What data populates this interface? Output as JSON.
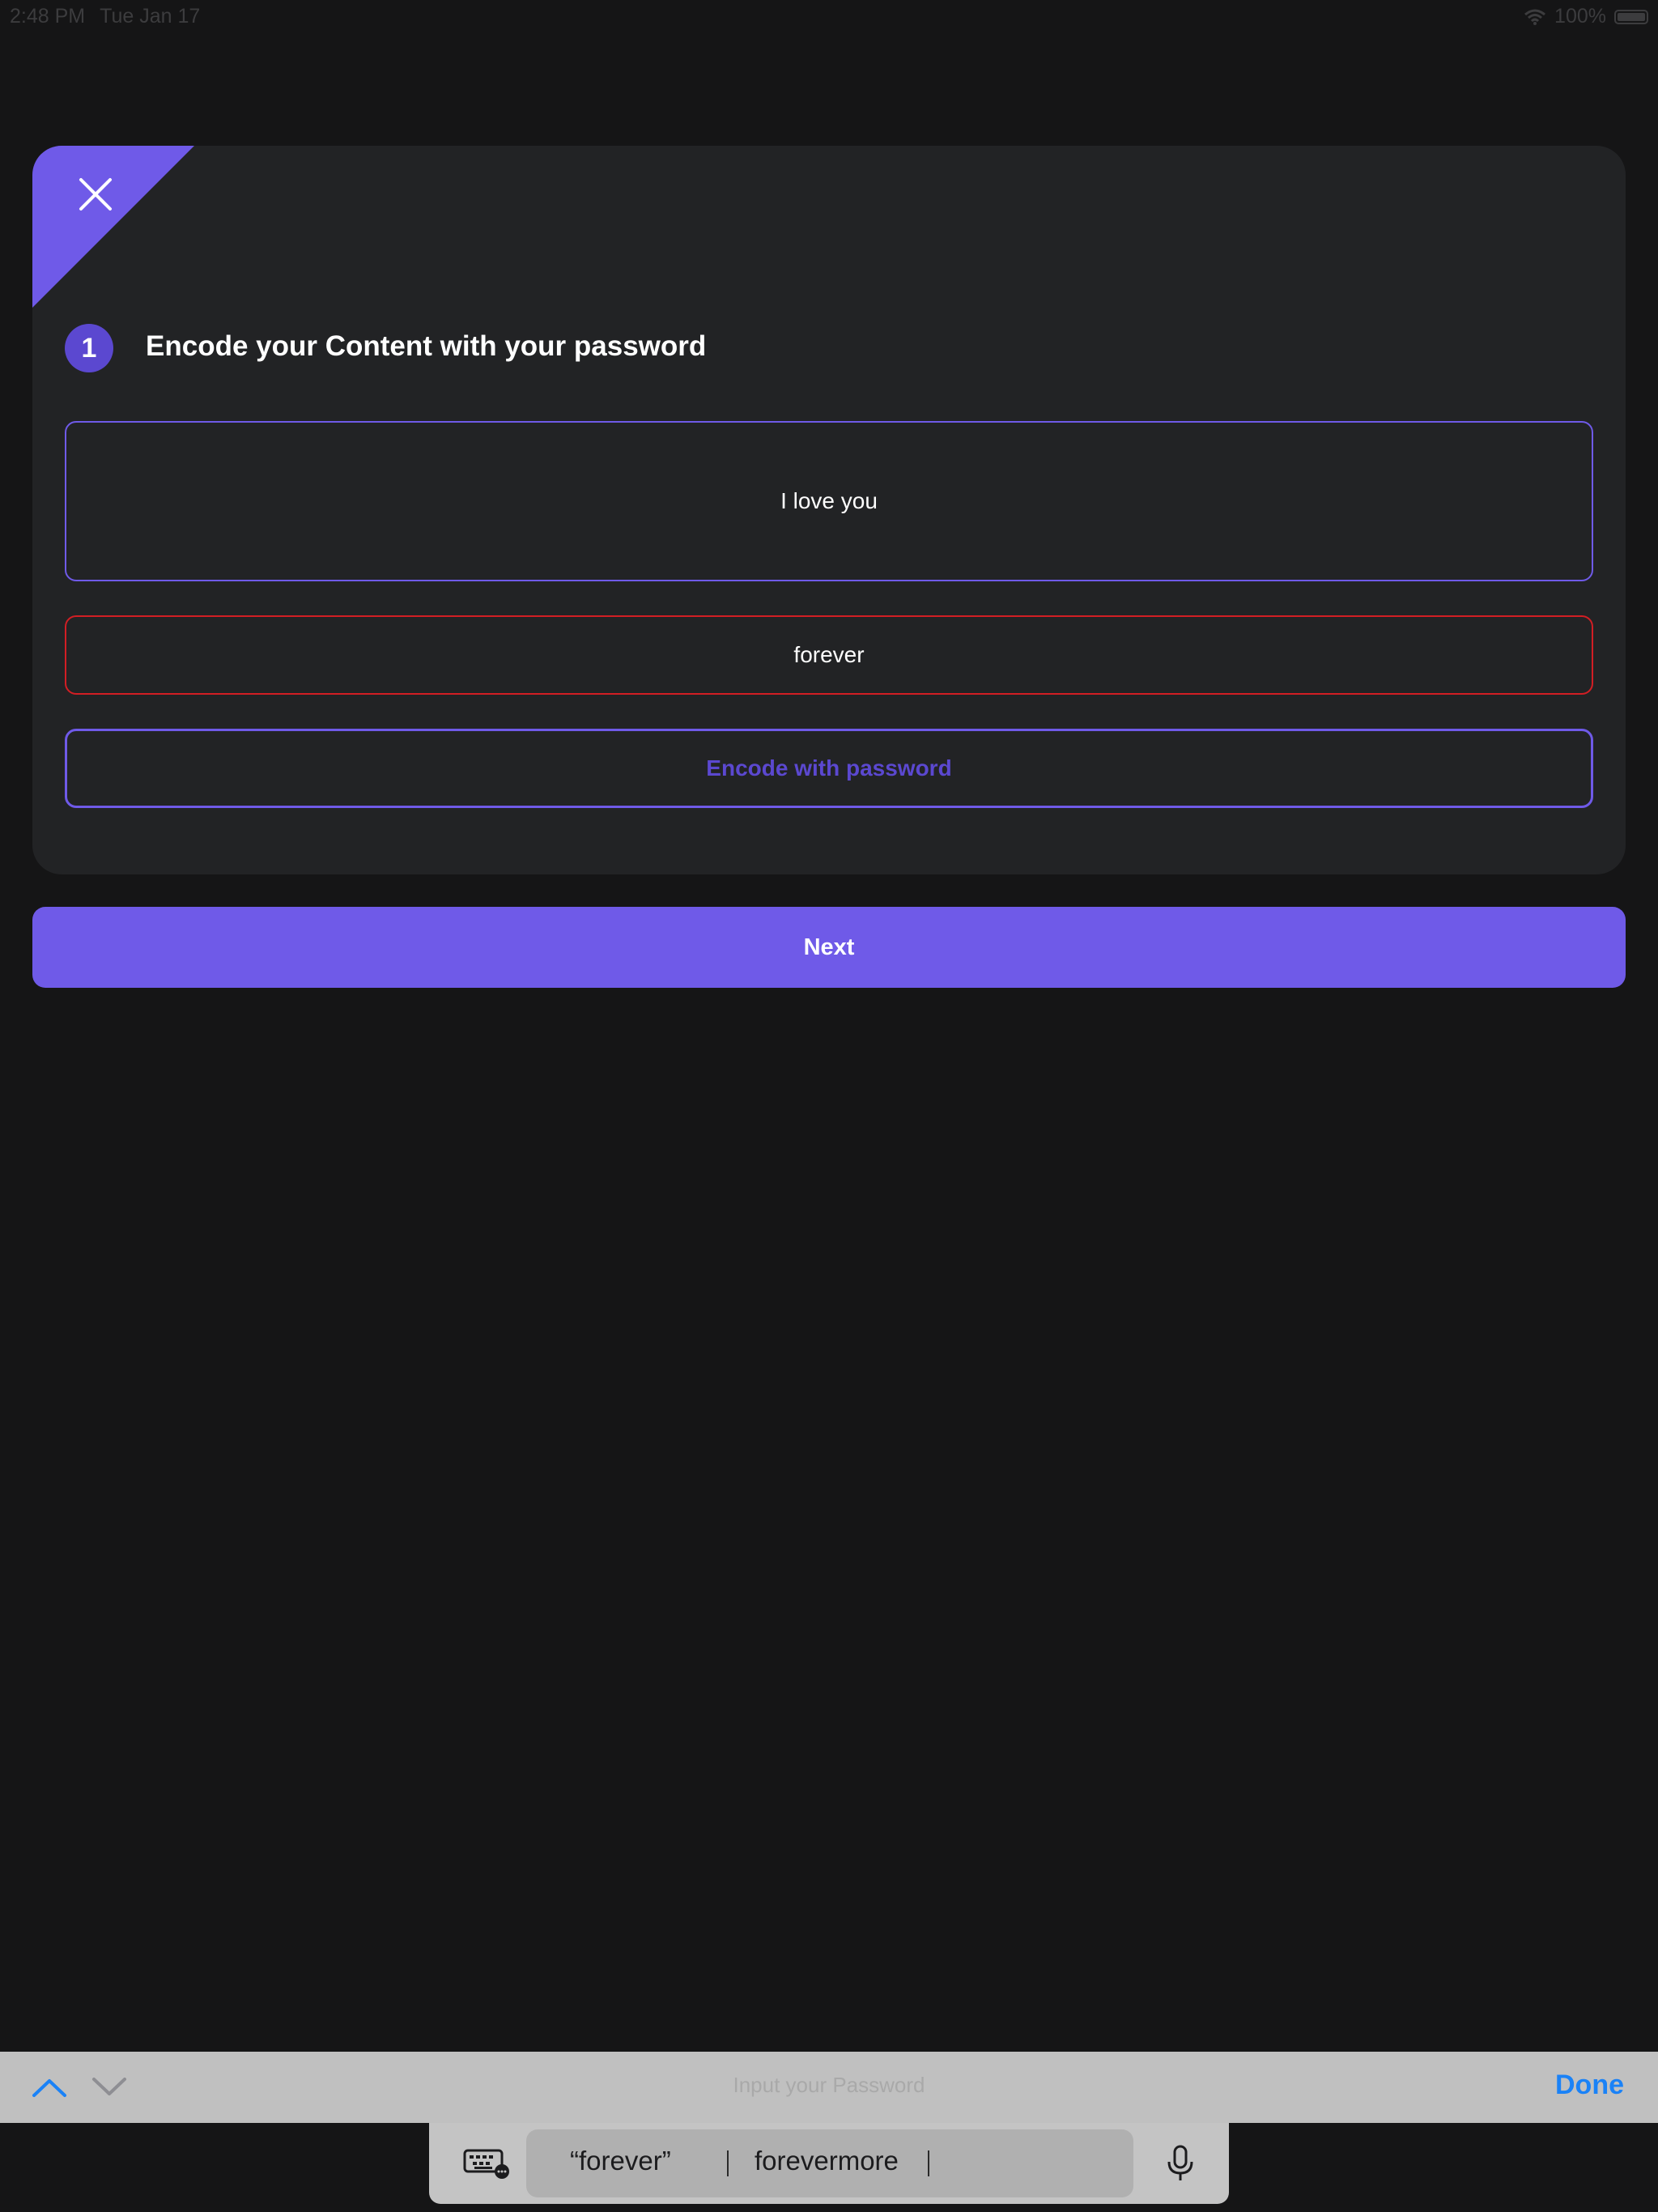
{
  "status_bar": {
    "time": "2:48 PM",
    "date": "Tue Jan 17",
    "battery_percent": "100%"
  },
  "card": {
    "step_number": "1",
    "step_title": "Encode your Content with your password",
    "content_value": "I love you",
    "password_value": "forever",
    "encode_button_label": "Encode with password"
  },
  "next_button_label": "Next",
  "keyboard_toolbar": {
    "placeholder": "Input your Password",
    "done_label": "Done"
  },
  "suggestions": {
    "items": [
      "“forever”",
      "forevermore"
    ]
  },
  "colors": {
    "accent": "#6f5ae8",
    "accent_dark": "#5b48d0",
    "error": "#d21e24",
    "done": "#1a82f7"
  },
  "icons": {
    "close": "close-icon",
    "wifi": "wifi-icon",
    "battery": "battery-icon",
    "up": "chevron-up-icon",
    "down": "chevron-down-icon",
    "keyboard": "keyboard-icon",
    "mic": "microphone-icon"
  }
}
